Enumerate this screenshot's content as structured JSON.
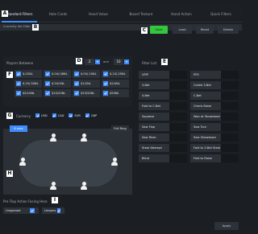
{
  "tabs": [
    "Standard Filters",
    "Hole Cards",
    "Hand Value",
    "Board Texture",
    "Hand Action",
    "Quick Filters"
  ],
  "badges": {
    "A": "A",
    "B": "B",
    "C": "C",
    "D": "D",
    "E": "E",
    "F": "F",
    "G": "G",
    "H": "H",
    "I": "I"
  },
  "saved": {
    "label": "Currently Set Filter"
  },
  "actions": {
    "save": "Save",
    "load": "Load",
    "reset": "Reset",
    "delete": "Delete"
  },
  "players": {
    "title": "Players Between",
    "min": "2",
    "and": "and",
    "max": "10",
    "stakes": [
      "$.02NL",
      "$.04/.08NL",
      "$.05/.10NL",
      "$.10/.25NL",
      "$.25/.50NL",
      "$.50/1NL",
      "$1/2NL",
      "$2/4NL",
      "$5/10NL",
      "$10/20NL",
      "$25/50NL",
      "$50NL"
    ]
  },
  "filters": {
    "title": "Filter List",
    "items": [
      "VPIP",
      "PFR",
      "3-Bet",
      "Called 3-Bet",
      "4-Bet",
      "C-Bet",
      "Fold to C-Bet",
      "Check-Raise",
      "Squeeze",
      "Won at Showdown",
      "Saw Flop",
      "Saw Turn",
      "Saw River",
      "Saw Showdown",
      "Steal Attempt",
      "Fold to 3-Bet Steal",
      "Blind",
      "Fold to Raise"
    ]
  },
  "currency": {
    "title": "Currency",
    "options": [
      "USD",
      "CAD",
      "EUR",
      "GBP"
    ]
  },
  "table": {
    "type_label": "6 max",
    "ring_label": "Full Ring"
  },
  "preflop": {
    "title": "Pre Flop Action Facing Hero",
    "options": [
      "Unopened",
      "Limpers"
    ]
  },
  "apply": "Apply",
  "colors": {
    "accent": "#3f8cff",
    "save": "#35c53f",
    "bg": "#1b1f23"
  }
}
